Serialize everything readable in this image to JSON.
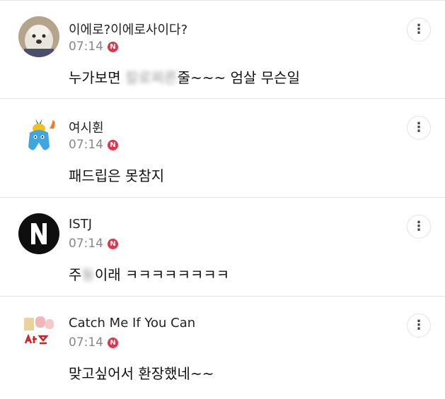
{
  "comments": [
    {
      "author": "이에로?이에로사이다?",
      "time": "07:14",
      "badge": "N",
      "text_blurred": "칼로찌른",
      "text_before": "누가보면 ",
      "text_after": "줄~~~ 엄살 무슨일",
      "avatar": "dog-photo-icon"
    },
    {
      "author": "여시휜",
      "time": "07:14",
      "badge": "N",
      "text": "패드립은 못참지",
      "avatar": "pineapple-tooth-character-icon"
    },
    {
      "author": "ISTJ",
      "time": "07:14",
      "badge": "N",
      "text_before": "주",
      "text_blurred": "둥",
      "text_after": "이래 ㅋㅋㅋㅋㅋㅋㅋㅋ",
      "avatar": "letter-n-icon"
    },
    {
      "author": "Catch Me If You Can",
      "time": "07:14",
      "badge": "N",
      "text": "맞고싶어서 환장했네~~",
      "avatar": "sticker-ayeot-icon"
    }
  ],
  "more_icon": "⋮",
  "colors": {
    "badge": "#e0344a",
    "divider": "#e6e6e6",
    "time": "#888888"
  }
}
